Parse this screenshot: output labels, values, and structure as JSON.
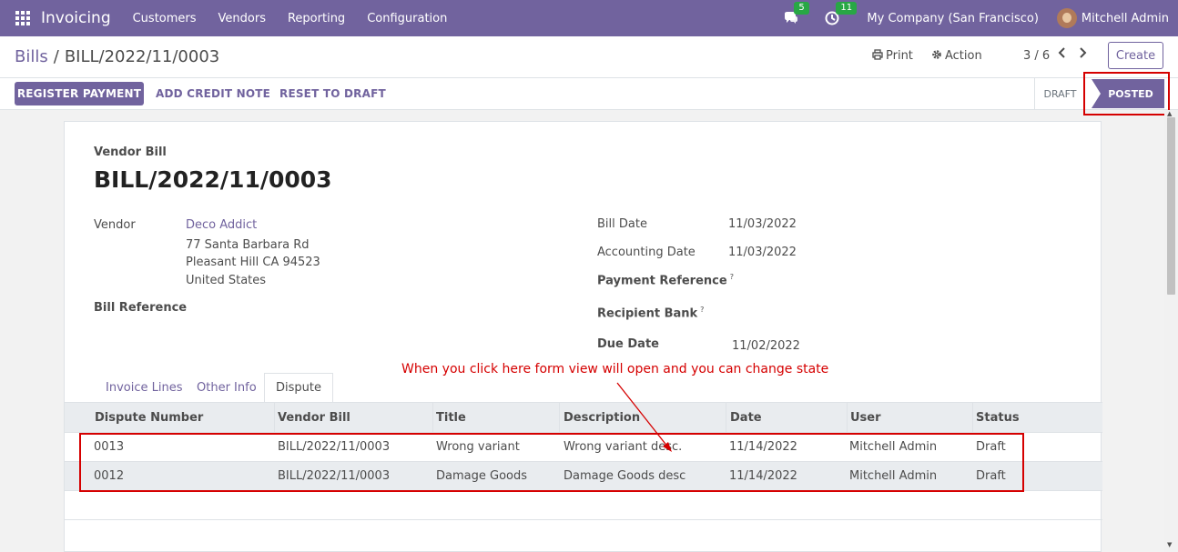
{
  "topnav": {
    "app_title": "Invoicing",
    "menu": [
      "Customers",
      "Vendors",
      "Reporting",
      "Configuration"
    ],
    "messages_badge": "5",
    "activities_badge": "11",
    "company": "My Company (San Francisco)",
    "user": "Mitchell Admin",
    "color": "#71639e"
  },
  "control_panel": {
    "breadcrumb_parent": "Bills",
    "breadcrumb_current": "BILL/2022/11/0003",
    "print_label": "Print",
    "action_label": "Action",
    "pager": "3 / 6",
    "create_label": "Create"
  },
  "statusbar": {
    "register_payment": "REGISTER PAYMENT",
    "add_credit_note": "ADD CREDIT NOTE",
    "reset_to_draft": "RESET TO DRAFT",
    "state_draft": "DRAFT",
    "state_posted": "POSTED"
  },
  "form": {
    "doc_type": "Vendor Bill",
    "title": "BILL/2022/11/0003",
    "vendor_label": "Vendor",
    "vendor_name": "Deco Addict",
    "vendor_address": [
      "77 Santa Barbara Rd",
      "Pleasant Hill CA 94523",
      "United States"
    ],
    "bill_reference_label": "Bill Reference",
    "bill_date_label": "Bill Date",
    "bill_date": "11/03/2022",
    "accounting_date_label": "Accounting Date",
    "accounting_date": "11/03/2022",
    "payment_reference_label": "Payment Reference",
    "recipient_bank_label": "Recipient Bank",
    "help_mark": "?",
    "due_date_label": "Due Date",
    "due_date": "11/02/2022"
  },
  "tabs": [
    "Invoice Lines",
    "Other Info",
    "Dispute"
  ],
  "active_tab": "Dispute",
  "dispute_table": {
    "columns": [
      "Dispute Number",
      "Vendor Bill",
      "Title",
      "Description",
      "Date",
      "User",
      "Status"
    ],
    "rows": [
      [
        "0013",
        "BILL/2022/11/0003",
        "Wrong variant",
        "Wrong variant desc.",
        "11/14/2022",
        "Mitchell Admin",
        "Draft"
      ],
      [
        "0012",
        "BILL/2022/11/0003",
        "Damage Goods",
        "Damage Goods desc",
        "11/14/2022",
        "Mitchell Admin",
        "Draft"
      ]
    ]
  },
  "annotation": {
    "text": "When you click here form view will open and you can change state",
    "color": "#d50000"
  }
}
